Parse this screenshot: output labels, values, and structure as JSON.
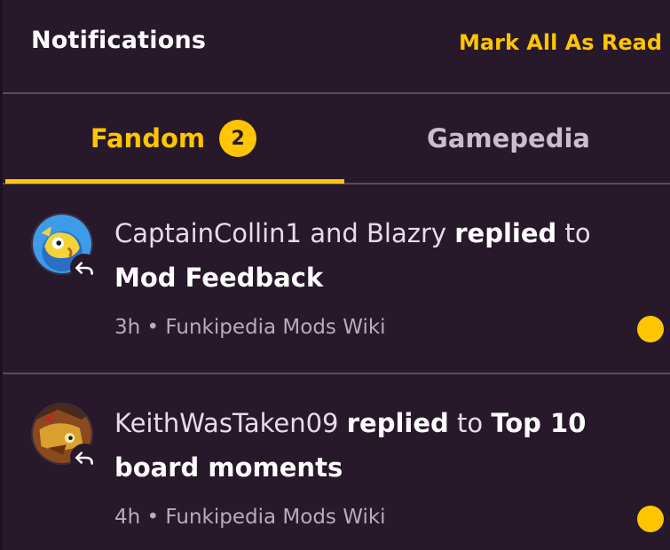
{
  "header": {
    "title": "Notifications",
    "mark_all": "Mark All As Read"
  },
  "tabs": [
    {
      "label": "Fandom",
      "badge": "2",
      "active": true
    },
    {
      "label": "Gamepedia",
      "active": false
    }
  ],
  "notifications": [
    {
      "actors": "CaptainCollin1 and Blazry",
      "action": "replied",
      "connector": "to",
      "target": "Mod Feedback",
      "time": "3h",
      "separator": "•",
      "wiki": "Funkipedia Mods Wiki",
      "unread": true
    },
    {
      "actors": "KeithWasTaken09",
      "action": "replied",
      "connector": "to",
      "target": "Top 10 board moments",
      "time": "4h",
      "separator": "•",
      "wiki": "Funkipedia Mods Wiki",
      "unread": true
    }
  ],
  "colors": {
    "background": "#27182a",
    "accent": "#ffc500",
    "divider": "#5a4a5c"
  },
  "icons": {
    "reply": "reply-arrow-icon",
    "unread": "unread-dot"
  }
}
